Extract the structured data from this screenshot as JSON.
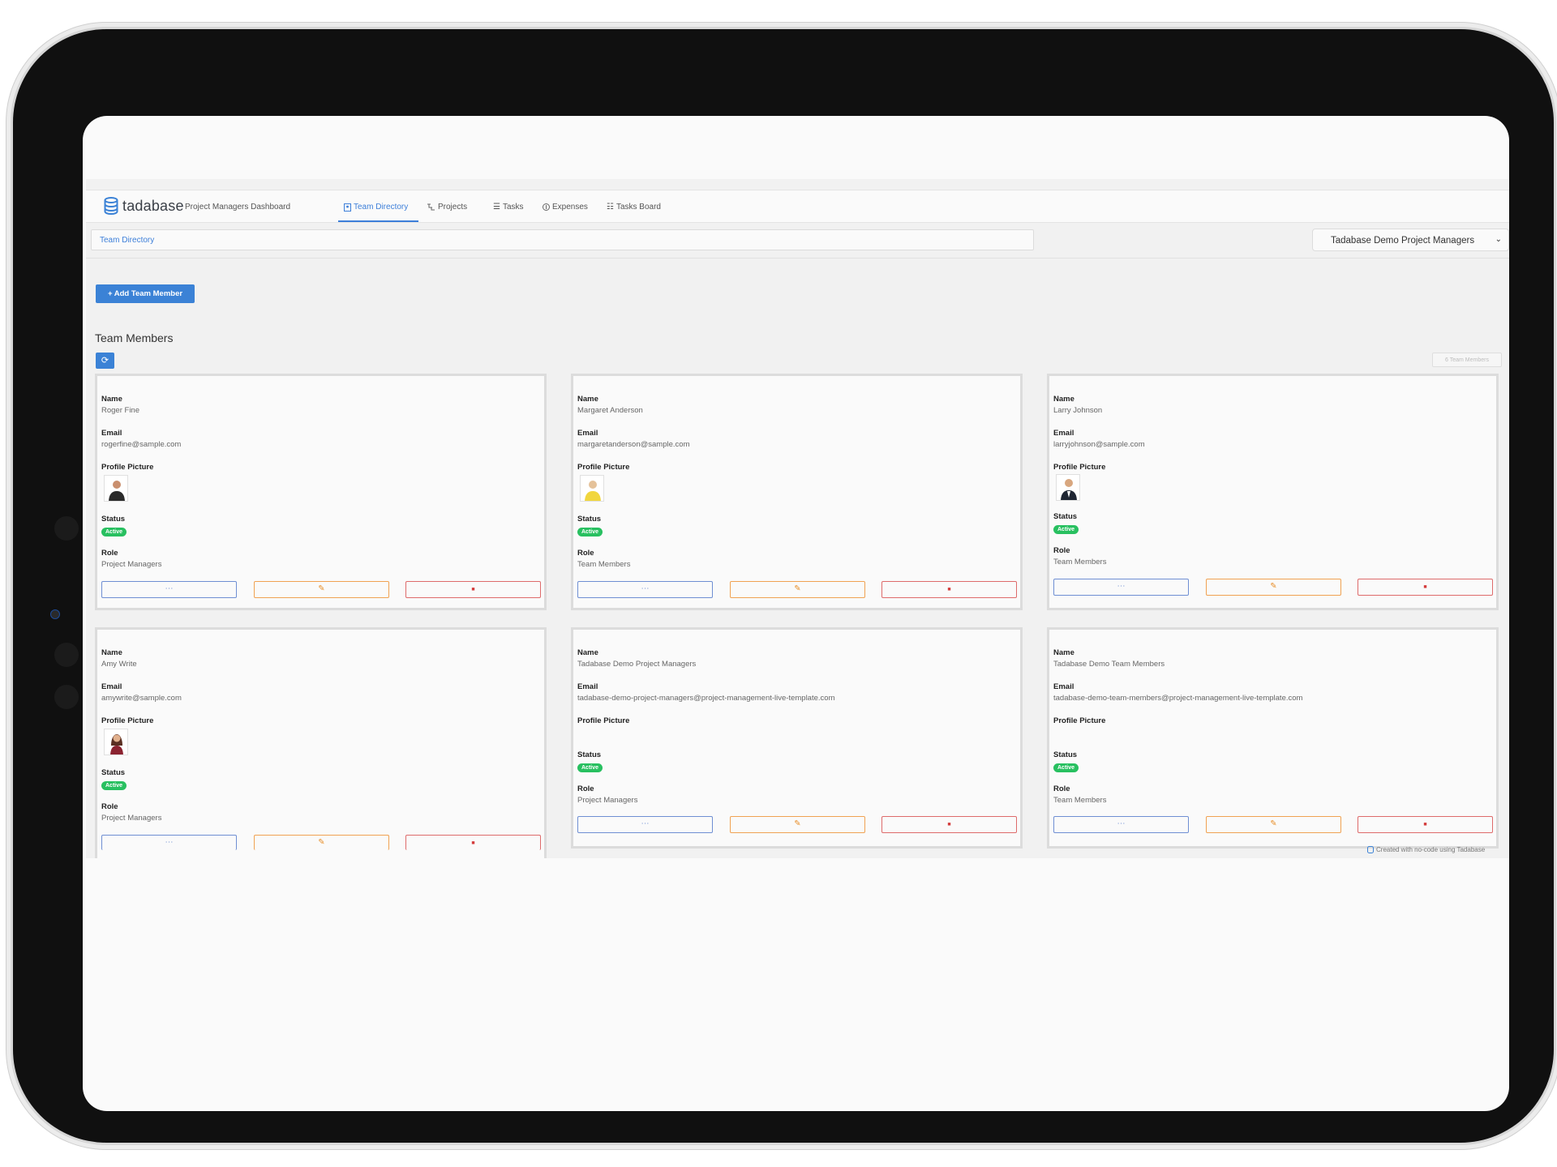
{
  "nav": {
    "logo_text": "tadabase",
    "items": [
      {
        "label": "Project Managers Dashboard",
        "icon": "none"
      },
      {
        "label": "Team Directory",
        "icon": "directory-icon"
      },
      {
        "label": "Projects",
        "icon": "projects-icon"
      },
      {
        "label": "Tasks",
        "icon": "list-icon"
      },
      {
        "label": "Expenses",
        "icon": "dollar-icon"
      },
      {
        "label": "Tasks Board",
        "icon": "board-icon"
      }
    ],
    "active": "Team Directory"
  },
  "breadcrumb": "Team Directory",
  "role_select": {
    "value": "Tadabase Demo Project Managers",
    "icon": "chevron-down-icon"
  },
  "toolbar": {
    "add_label": "+ Add Team Member",
    "refresh_icon": "refresh-icon"
  },
  "section": {
    "title": "Team Members",
    "count_label": "6 Team Members"
  },
  "field_labels": {
    "name": "Name",
    "email": "Email",
    "picture": "Profile Picture",
    "status": "Status",
    "role": "Role"
  },
  "members": [
    {
      "name": "Roger Fine",
      "email": "rogerfine@sample.com",
      "status": "Active",
      "role": "Project Managers",
      "has_picture": true
    },
    {
      "name": "Margaret Anderson",
      "email": "margaretanderson@sample.com",
      "status": "Active",
      "role": "Team Members",
      "has_picture": true
    },
    {
      "name": "Larry Johnson",
      "email": "larryjohnson@sample.com",
      "status": "Active",
      "role": "Team Members",
      "has_picture": true
    },
    {
      "name": "Amy Write",
      "email": "amywrite@sample.com",
      "status": "Active",
      "role": "Project Managers",
      "has_picture": true
    },
    {
      "name": "Tadabase Demo Project Managers",
      "email": "tadabase-demo-project-managers@project-management-live-template.com",
      "status": "Active",
      "role": "Project Managers",
      "has_picture": false
    },
    {
      "name": "Tadabase Demo Team Members",
      "email": "tadabase-demo-team-members@project-management-live-template.com",
      "status": "Active",
      "role": "Team Members",
      "has_picture": false
    }
  ],
  "actions": {
    "view": {
      "glyph": "⋯",
      "icon": "view-details-icon"
    },
    "edit": {
      "glyph": "✎",
      "icon": "pencil-icon"
    },
    "delete": {
      "glyph": "■",
      "icon": "trash-icon"
    }
  },
  "footer": {
    "credit": "Created with no-code using Tadabase"
  },
  "colors": {
    "accent": "#3b82d6",
    "status_active": "#28c060",
    "edit": "#f0a252",
    "delete": "#de6b6b",
    "view": "#6f8fd3"
  }
}
